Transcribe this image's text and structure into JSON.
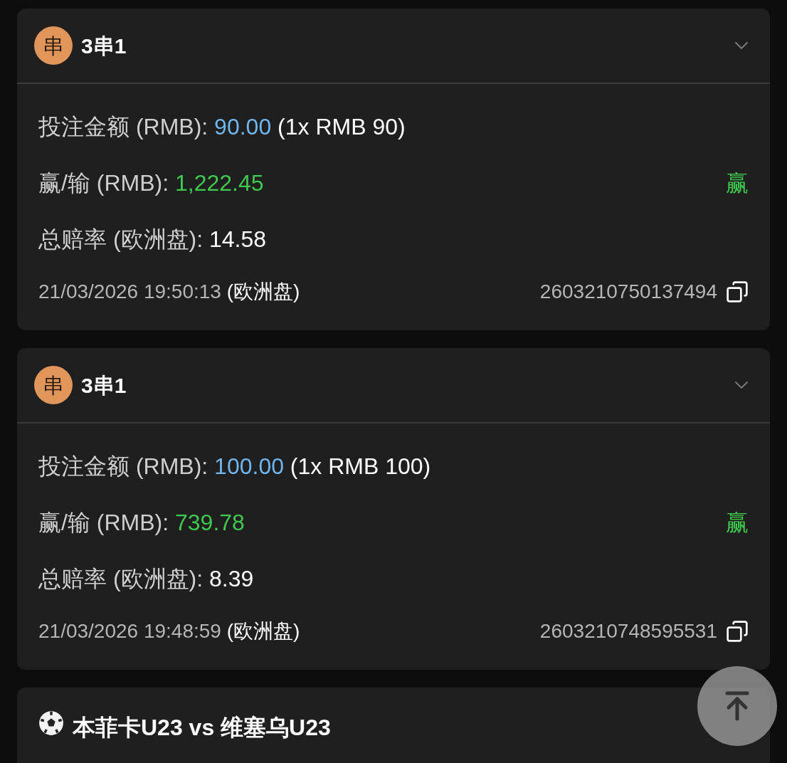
{
  "bets": [
    {
      "badge": "串",
      "title": "3串1",
      "expanded": false,
      "stake_label": "投注金额 (RMB):",
      "stake": "90.00",
      "stake_detail": "(1x RMB 90)",
      "result_label": "赢/输 (RMB):",
      "result": "1,222.45",
      "outcome": "赢",
      "won": true,
      "odds_label": "总赔率 (欧洲盘):",
      "odds": "14.58",
      "datetime": "21/03/2026 19:50:13",
      "odds_type": "(欧洲盘)",
      "ticket": "2603210750137494"
    },
    {
      "badge": "串",
      "title": "3串1",
      "expanded": false,
      "stake_label": "投注金额 (RMB):",
      "stake": "100.00",
      "stake_detail": "(1x RMB 100)",
      "result_label": "赢/输 (RMB):",
      "result": "739.78",
      "outcome": "赢",
      "won": true,
      "odds_label": "总赔率 (欧洲盘):",
      "odds": "8.39",
      "datetime": "21/03/2026 19:48:59",
      "odds_type": "(欧洲盘)",
      "ticket": "2603210748595531"
    }
  ],
  "match": {
    "title": "本菲卡U23 vs 维塞乌U23"
  }
}
